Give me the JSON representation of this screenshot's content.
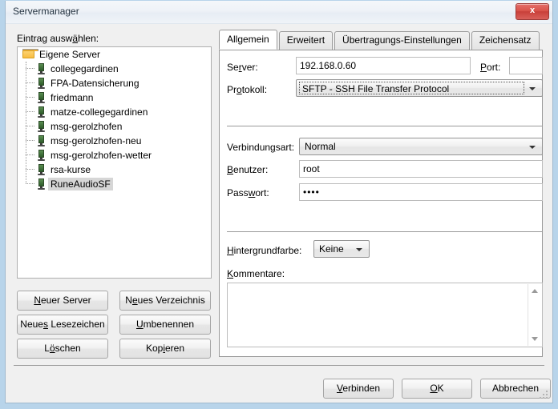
{
  "window": {
    "title": "Servermanager",
    "close_icon": "close-icon",
    "close_label": "x"
  },
  "left": {
    "label": "Eintrag auswählen:",
    "tree": {
      "root": {
        "label": "Eigene Server",
        "icon": "folder-icon"
      },
      "items": [
        {
          "label": "collegegardinen",
          "icon": "server-icon",
          "selected": false
        },
        {
          "label": "FPA-Datensicherung",
          "icon": "server-icon",
          "selected": false
        },
        {
          "label": "friedmann",
          "icon": "server-icon",
          "selected": false
        },
        {
          "label": "matze-collegegardinen",
          "icon": "server-icon",
          "selected": false
        },
        {
          "label": "msg-gerolzhofen",
          "icon": "server-icon",
          "selected": false
        },
        {
          "label": "msg-gerolzhofen-neu",
          "icon": "server-icon",
          "selected": false
        },
        {
          "label": "msg-gerolzhofen-wetter",
          "icon": "server-icon",
          "selected": false
        },
        {
          "label": "rsa-kurse",
          "icon": "server-icon",
          "selected": false
        },
        {
          "label": "RuneAudioSF",
          "icon": "server-icon",
          "selected": true
        }
      ]
    },
    "buttons": {
      "new_server": "Neuer Server",
      "new_folder": "Neues Verzeichnis",
      "new_bookmark": "Neues Lesezeichen",
      "rename": "Umbenennen",
      "delete": "Löschen",
      "copy": "Kopieren"
    }
  },
  "tabs": [
    {
      "label": "Allgemein",
      "active": true
    },
    {
      "label": "Erweitert",
      "active": false
    },
    {
      "label": "Übertragungs-Einstellungen",
      "active": false
    },
    {
      "label": "Zeichensatz",
      "active": false
    }
  ],
  "general": {
    "server_label": "Server:",
    "server_value": "192.168.0.60",
    "port_label": "Port:",
    "port_value": "",
    "protocol_label": "Protokoll:",
    "protocol_value": "SFTP - SSH File Transfer Protocol",
    "logontype_label": "Verbindungsart:",
    "logontype_value": "Normal",
    "user_label": "Benutzer:",
    "user_value": "root",
    "password_label": "Passwort:",
    "password_value": "••••",
    "bgcolor_label": "Hintergrundfarbe:",
    "bgcolor_value": "Keine",
    "comments_label": "Kommentare:",
    "comments_value": ""
  },
  "footer": {
    "connect": "Verbinden",
    "ok": "OK",
    "cancel": "Abbrechen"
  },
  "colors": {
    "window_border": "#b8d4ea",
    "dialog_bg": "#f0f0f0",
    "close_red": "#d9534a",
    "selection": "#d6d6d6"
  }
}
